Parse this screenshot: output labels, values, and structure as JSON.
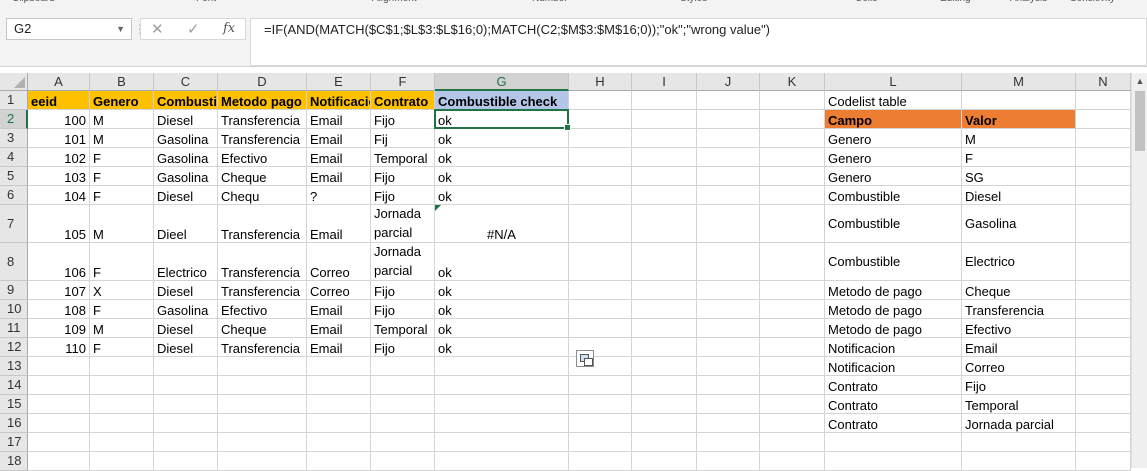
{
  "ribbon": {
    "groups": [
      "Clipboard",
      "Font",
      "Alignment",
      "Number",
      "Styles",
      "Cells",
      "Editing",
      "Analysis",
      "Sensitivity"
    ]
  },
  "formula_bar": {
    "name_box": "G2",
    "cancel_icon": "✕",
    "enter_icon": "✓",
    "fx_label": "fx",
    "formula": "=IF(AND(MATCH($C$1;$L$3:$L$16;0);MATCH(C2;$M$3:$M$16;0));\"ok\";\"wrong value\")"
  },
  "sheet": {
    "selected_cell": "G2",
    "columns": [
      "A",
      "B",
      "C",
      "D",
      "E",
      "F",
      "G",
      "H",
      "I",
      "J",
      "K",
      "L",
      "M",
      "N"
    ],
    "rows": [
      "1",
      "2",
      "3",
      "4",
      "5",
      "6",
      "7",
      "8",
      "9",
      "10",
      "11",
      "12",
      "13",
      "14",
      "15",
      "16",
      "17",
      "18"
    ],
    "headers": [
      "eeid",
      "Genero",
      "Combustible",
      "Metodo pago",
      "Notificacion",
      "Contrato",
      "Combustible check"
    ],
    "data": [
      [
        "100",
        "M",
        "Diesel",
        "Transferencia",
        "Email",
        "Fijo",
        "ok"
      ],
      [
        "101",
        "M",
        "Gasolina",
        "Transferencia",
        "Email",
        "Fij",
        "ok"
      ],
      [
        "102",
        "F",
        "Gasolina",
        "Efectivo",
        "Email",
        "Temporal",
        "ok"
      ],
      [
        "103",
        "F",
        "Gasolina",
        "Cheque",
        "Email",
        "Fijo",
        "ok"
      ],
      [
        "104",
        "F",
        "Diesel",
        "Chequ",
        "?",
        "Fijo",
        "ok"
      ],
      [
        "105",
        "M",
        "Dieel",
        "Transferencia",
        "Email",
        "Jornada parcial",
        "#N/A"
      ],
      [
        "106",
        "F",
        "Electrico",
        "Transferencia",
        "Correo",
        "Jornada parcial",
        "ok"
      ],
      [
        "107",
        "X",
        "Diesel",
        "Transferencia",
        "Correo",
        "Fijo",
        "ok"
      ],
      [
        "108",
        "F",
        "Gasolina",
        "Efectivo",
        "Email",
        "Fijo",
        "ok"
      ],
      [
        "109",
        "M",
        "Diesel",
        "Cheque",
        "Email",
        "Temporal",
        "ok"
      ],
      [
        "110",
        "F",
        "Diesel",
        "Transferencia",
        "Email",
        "Fijo",
        "ok"
      ]
    ],
    "codelist_title": "Codelist table",
    "codelist_headers": [
      "Campo",
      "Valor"
    ],
    "codelist": [
      [
        "Genero",
        "M"
      ],
      [
        "Genero",
        "F"
      ],
      [
        "Genero",
        "SG"
      ],
      [
        "Combustible",
        "Diesel"
      ],
      [
        "Combustible",
        "Gasolina"
      ],
      [
        "Combustible",
        "Electrico"
      ],
      [
        "Metodo de pago",
        "Cheque"
      ],
      [
        "Metodo de pago",
        "Transferencia"
      ],
      [
        "Metodo de pago",
        "Efectivo"
      ],
      [
        "Notificacion",
        "Email"
      ],
      [
        "Notificacion",
        "Correo"
      ],
      [
        "Contrato",
        "Fijo"
      ],
      [
        "Contrato",
        "Temporal"
      ],
      [
        "Contrato",
        "Jornada parcial"
      ]
    ]
  },
  "colors": {
    "header_fill": "#ffc000",
    "codelist_header_fill": "#ed7d31",
    "check_header_fill": "#b4c6e7",
    "selection": "#217346"
  }
}
